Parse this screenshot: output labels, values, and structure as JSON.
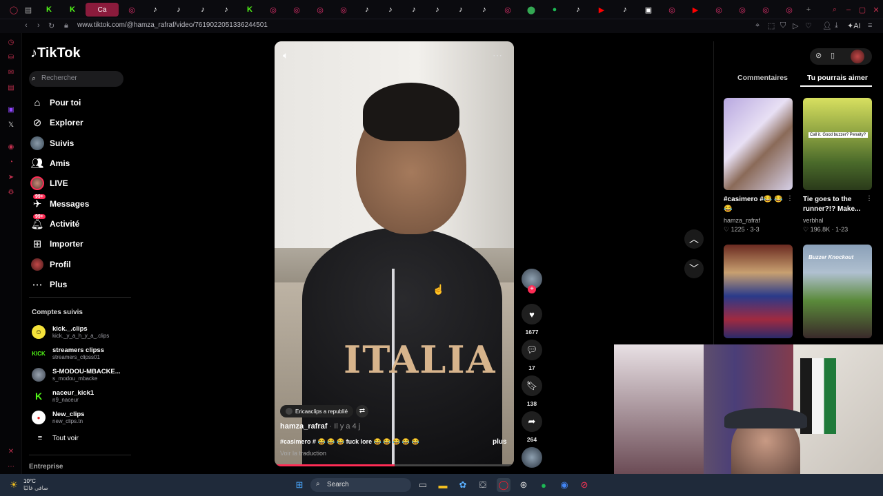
{
  "browser": {
    "url": "www.tiktok.com/@hamza_rafraf/video/7619022051336244501",
    "active_tab_label": "Ca"
  },
  "tiktok": {
    "logo": "TikTok",
    "search_placeholder": "Rechercher",
    "nav": [
      {
        "label": "Pour toi",
        "icon": "home-icon"
      },
      {
        "label": "Explorer",
        "icon": "compass-icon"
      },
      {
        "label": "Suivis",
        "icon": "avatar"
      },
      {
        "label": "Amis",
        "icon": "friends-icon"
      },
      {
        "label": "LIVE",
        "icon": "avatar"
      },
      {
        "label": "Messages",
        "icon": "message-icon",
        "badge": "99+"
      },
      {
        "label": "Activité",
        "icon": "bell-icon",
        "badge": "99+"
      },
      {
        "label": "Importer",
        "icon": "upload-icon"
      },
      {
        "label": "Profil",
        "icon": "avatar"
      },
      {
        "label": "Plus",
        "icon": "more-icon"
      }
    ],
    "followed_title": "Comptes suivis",
    "followed": [
      {
        "name": "kick._.clips",
        "handle": "kick._y_a_h_y_a_.clips"
      },
      {
        "name": "streamers clipss",
        "handle": "streamers_clipss01"
      },
      {
        "name": "S-MODOU-MBACKE...",
        "handle": "s_modou_mbacke"
      },
      {
        "name": "naceur_kick1",
        "handle": "n9_naceur"
      },
      {
        "name": "New_clips",
        "handle": "new_clips.tn"
      }
    ],
    "see_all": "Tout voir",
    "footer": "Entreprise"
  },
  "video": {
    "repost_text": "Ericaaclips a republié",
    "author": "hamza_rafraf",
    "time_ago": " · Il y a 4 j",
    "caption": "#casimero # 😂 😂 😂  fuck lore 😂 😂 😂 😂 😂",
    "more": "plus",
    "translate": "Voir la traduction",
    "shirt_text": "ITALIA",
    "progress": 0.5
  },
  "actions": {
    "likes": "1677",
    "comments": "17",
    "saves": "138",
    "shares": "264"
  },
  "right_panel": {
    "tab_comments": "Commentaires",
    "tab_suggest": "Tu pourrais aimer",
    "cards": [
      {
        "title1": "#casimero #😂 😂",
        "title2": "😂",
        "user": "hamza_rafraf",
        "stats": "♡ 1225 · 3-3"
      },
      {
        "title1": "Tie goes to the",
        "title2": "runner?!?  Make...",
        "user": "verbhal",
        "stats": "♡ 196.8K · 1-23"
      }
    ],
    "overlay_text": "Call it. Good buzzer? Penalty?",
    "card4_text": "Buzzer Knockout"
  },
  "taskbar": {
    "weather_temp": "10°C",
    "weather_desc": "صافي غالبًا",
    "search": "Search"
  }
}
